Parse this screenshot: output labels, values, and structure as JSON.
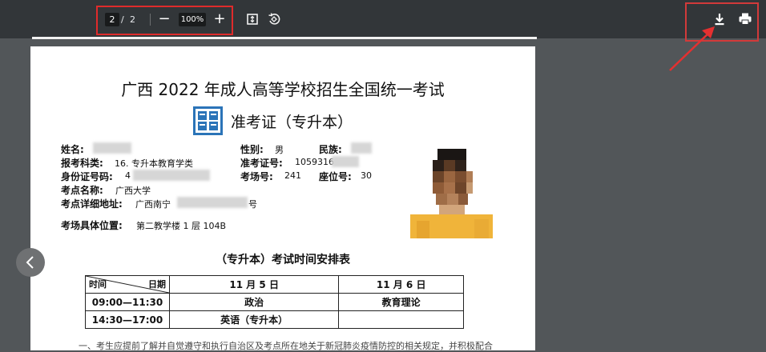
{
  "toolbar": {
    "page_current": "2",
    "page_separator": "/",
    "page_total": "2",
    "zoom_out": "−",
    "zoom_level": "100%",
    "zoom_in": "+",
    "icons": [
      "fit-page-icon",
      "rotate-icon",
      "download-icon",
      "print-icon"
    ]
  },
  "document": {
    "title": "广西 2022 年成人高等学校招生全国统一考试",
    "subtitle": "准考证（专升本）",
    "fields": {
      "name_label": "姓名:",
      "gender_label": "性别:",
      "gender_value": "男",
      "ethnicity_label": "民族:",
      "subject_label": "报考科类:",
      "subject_value": "16. 专升本教育学类",
      "ticket_label": "准考证号:",
      "ticket_value": "1059316",
      "id_label": "身份证号码:",
      "id_value": "4",
      "room_label": "考场号:",
      "room_value": "241",
      "seat_label": "座位号:",
      "seat_value": "30",
      "center_label": "考点名称:",
      "center_value": "广西大学",
      "address_label": "考点详细地址:",
      "address_value_start": "广西南宁",
      "address_value_end": "号",
      "location_label": "考场具体位置:",
      "location_value": "第二教学楼 1 层 104B"
    },
    "schedule": {
      "title": "（专升本）考试时间安排表",
      "corner_time": "时间",
      "corner_date": "日期",
      "dates": [
        "11 月 5 日",
        "11 月 6 日"
      ],
      "rows": [
        {
          "time": "09:00—11:30",
          "day1": "政治",
          "day2": "教育理论"
        },
        {
          "time": "14:30—17:00",
          "day1": "英语（专升本）",
          "day2": ""
        }
      ]
    },
    "notes_line": "一、考生应提前了解并自觉遵守和执行自治区及考点所在地关于新冠肺炎疫情防控的相关规定，并积极配合"
  },
  "colors": {
    "toolbar_bg": "#323639",
    "viewer_bg": "#525659",
    "highlight_red": "#e02b2b",
    "logo_blue": "#2b74b8",
    "photo_shirt": "#f0b43a"
  }
}
